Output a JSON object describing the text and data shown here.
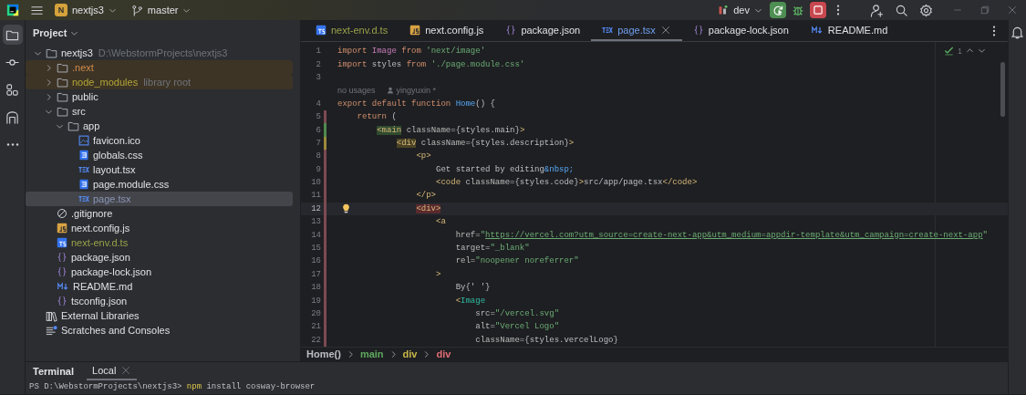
{
  "titlebar": {
    "project": {
      "badge": "N",
      "name": "nextjs3"
    },
    "branch": "master",
    "run_config": "dev"
  },
  "toolstrip": [
    {
      "kind": "folder",
      "selected": true
    },
    {
      "kind": "commit",
      "selected": false
    },
    {
      "kind": "structure",
      "selected": false
    },
    {
      "kind": "arch",
      "selected": false
    },
    {
      "kind": "more",
      "selected": false
    }
  ],
  "project": {
    "title": "Project",
    "tree": [
      {
        "label": "nextjs3",
        "hint": "D:\\WebstormProjects\\nextjs3",
        "kind": "folder",
        "expanded": true,
        "selected": false,
        "highlighted": false,
        "children": [
          {
            "label": ".next",
            "kind": "folder",
            "expanded": false,
            "selected": false,
            "highlighted": true,
            "color": "#d08b4c"
          },
          {
            "label": "node_modules",
            "hint": "library root",
            "kind": "folder",
            "expanded": false,
            "selected": false,
            "highlighted": true,
            "color": "#b3a536"
          },
          {
            "label": "public",
            "kind": "folder",
            "expanded": false,
            "selected": false,
            "highlighted": false
          },
          {
            "label": "src",
            "kind": "folder",
            "expanded": true,
            "selected": false,
            "highlighted": false,
            "children": [
              {
                "label": "app",
                "kind": "folder",
                "expanded": true,
                "selected": false,
                "highlighted": false,
                "children": [
                  {
                    "label": "favicon.ico",
                    "kind": "image",
                    "selected": false,
                    "highlighted": false
                  },
                  {
                    "label": "globals.css",
                    "kind": "css",
                    "selected": false,
                    "highlighted": false
                  },
                  {
                    "label": "layout.tsx",
                    "kind": "tsx",
                    "selected": false,
                    "highlighted": false
                  },
                  {
                    "label": "page.module.css",
                    "kind": "css",
                    "selected": false,
                    "highlighted": false
                  },
                  {
                    "label": "page.tsx",
                    "kind": "tsx",
                    "selected": true,
                    "highlighted": false,
                    "color": "#8b95b5"
                  }
                ]
              }
            ]
          },
          {
            "label": ".gitignore",
            "kind": "ignore",
            "selected": false,
            "highlighted": false
          },
          {
            "label": "next.config.js",
            "kind": "js",
            "selected": false,
            "highlighted": false
          },
          {
            "label": "next-env.d.ts",
            "kind": "ts",
            "selected": false,
            "highlighted": false,
            "color": "#9aa24a"
          },
          {
            "label": "package.json",
            "kind": "json",
            "selected": false,
            "highlighted": false
          },
          {
            "label": "package-lock.json",
            "kind": "json",
            "selected": false,
            "highlighted": false
          },
          {
            "label": "README.md",
            "kind": "md",
            "selected": false,
            "highlighted": false
          },
          {
            "label": "tsconfig.json",
            "kind": "json",
            "selected": false,
            "highlighted": false
          }
        ]
      },
      {
        "label": "External Libraries",
        "kind": "libraries",
        "selected": false,
        "highlighted": false
      },
      {
        "label": "Scratches and Consoles",
        "kind": "scratches",
        "selected": false,
        "highlighted": false
      }
    ]
  },
  "editor": {
    "tabs": [
      {
        "label": "next-env.d.ts",
        "kind": "ts",
        "selected": false,
        "color": "#9aa24a"
      },
      {
        "label": "next.config.js",
        "kind": "js",
        "selected": false,
        "color": "#dfe1e5"
      },
      {
        "label": "package.json",
        "kind": "json",
        "selected": false,
        "color": "#dfe1e5"
      },
      {
        "label": "page.tsx",
        "kind": "tsx",
        "selected": true,
        "color": "#6f9ff0"
      },
      {
        "label": "package-lock.json",
        "kind": "json",
        "selected": false,
        "color": "#dfe1e5"
      },
      {
        "label": "README.md",
        "kind": "md",
        "selected": false,
        "color": "#dfe1e5"
      }
    ],
    "inspection": {
      "count": "1"
    },
    "lines": [
      {
        "kind": "code",
        "number": "1",
        "current": false,
        "tokens": [
          {
            "kind": "kw",
            "text": "import "
          },
          {
            "kind": "type",
            "text": "Image"
          },
          {
            "kind": "kw",
            "text": " from "
          },
          {
            "kind": "str",
            "text": "'next/image'"
          }
        ]
      },
      {
        "kind": "code",
        "number": "2",
        "current": false,
        "tokens": [
          {
            "kind": "kw",
            "text": "import "
          },
          {
            "kind": "plain",
            "text": "styles "
          },
          {
            "kind": "kw",
            "text": "from "
          },
          {
            "kind": "str",
            "text": "'./page.module.css'"
          }
        ]
      },
      {
        "kind": "code",
        "number": "3",
        "current": false
      },
      {
        "kind": "hint",
        "usages": "no usages",
        "author": "yingyuxin *"
      },
      {
        "kind": "code",
        "number": "4",
        "current": false,
        "tokens": [
          {
            "kind": "kw",
            "text": "export default function "
          },
          {
            "kind": "fn",
            "text": "Home"
          },
          {
            "kind": "plain",
            "text": "() {"
          }
        ]
      },
      {
        "kind": "code",
        "number": "5",
        "current": false,
        "color": "#7c4a52",
        "tokens": [
          {
            "kind": "kw",
            "text": "    return"
          },
          {
            "kind": "plain",
            "text": " ("
          }
        ]
      },
      {
        "kind": "code",
        "number": "6",
        "current": false,
        "color": "#4f8a4f",
        "tokens": [
          {
            "kind": "tag-scope",
            "text": "        <main"
          },
          {
            "kind": "attr",
            "text": " className"
          },
          {
            "kind": "plain",
            "text": "={styles.main}"
          },
          {
            "kind": "tag",
            "text": ">"
          }
        ]
      },
      {
        "kind": "code",
        "number": "7",
        "current": false,
        "color": "#9b8a3c",
        "tokens": [
          {
            "kind": "tag-parent",
            "text": "            <div"
          },
          {
            "kind": "attr",
            "text": " className"
          },
          {
            "kind": "plain",
            "text": "={styles.description}"
          },
          {
            "kind": "tag",
            "text": ">"
          }
        ]
      },
      {
        "kind": "code",
        "number": "8",
        "current": false,
        "color": "#7c4a52",
        "tokens": [
          {
            "kind": "tag",
            "text": "                <p>"
          }
        ]
      },
      {
        "kind": "code",
        "number": "9",
        "current": false,
        "color": "#7c4a52",
        "tokens": [
          {
            "kind": "plain",
            "text": "                    Get started by editing"
          },
          {
            "kind": "entity",
            "text": "&nbsp;"
          }
        ]
      },
      {
        "kind": "code",
        "number": "10",
        "current": false,
        "color": "#7c4a52",
        "tokens": [
          {
            "kind": "tag",
            "text": "                    <code"
          },
          {
            "kind": "attr",
            "text": " className"
          },
          {
            "kind": "plain",
            "text": "={styles.code}"
          },
          {
            "kind": "tag",
            "text": ">"
          },
          {
            "kind": "plain",
            "text": "src/app/page.tsx"
          },
          {
            "kind": "tag",
            "text": "</code>"
          }
        ]
      },
      {
        "kind": "code",
        "number": "11",
        "current": false,
        "color": "#7c4a52",
        "tokens": [
          {
            "kind": "tag",
            "text": "                </p>"
          }
        ]
      },
      {
        "kind": "code",
        "number": "12",
        "current": true,
        "color": "#7c4a52",
        "tokens": [
          {
            "kind": "tag-current",
            "text": "                <div>"
          }
        ]
      },
      {
        "kind": "code",
        "number": "13",
        "current": false,
        "color": "#7c4a52",
        "tokens": [
          {
            "kind": "tag",
            "text": "                    <a"
          }
        ]
      },
      {
        "kind": "code",
        "number": "14",
        "current": false,
        "color": "#7c4a52",
        "tokens": [
          {
            "kind": "attr",
            "text": "                        href="
          },
          {
            "kind": "str",
            "text": "\""
          },
          {
            "kind": "link",
            "text": "https://vercel.com?utm_source=create-next-app&utm_medium=appdir-template&utm_campaign=create-next-app"
          },
          {
            "kind": "str",
            "text": "\""
          }
        ]
      },
      {
        "kind": "code",
        "number": "15",
        "current": false,
        "color": "#7c4a52",
        "tokens": [
          {
            "kind": "attr",
            "text": "                        target="
          },
          {
            "kind": "str",
            "text": "\"_blank\""
          }
        ]
      },
      {
        "kind": "code",
        "number": "16",
        "current": false,
        "color": "#7c4a52",
        "tokens": [
          {
            "kind": "attr",
            "text": "                        rel="
          },
          {
            "kind": "str",
            "text": "\"noopener noreferrer\""
          }
        ]
      },
      {
        "kind": "code",
        "number": "17",
        "current": false,
        "color": "#7c4a52",
        "tokens": [
          {
            "kind": "tag",
            "text": "                    >"
          }
        ]
      },
      {
        "kind": "code",
        "number": "18",
        "current": false,
        "color": "#7c4a52",
        "tokens": [
          {
            "kind": "plain",
            "text": "                        By{' '}"
          }
        ]
      },
      {
        "kind": "code",
        "number": "19",
        "current": false,
        "color": "#7c4a52",
        "tokens": [
          {
            "kind": "tag",
            "text": "                        <"
          },
          {
            "kind": "comp",
            "text": "Image"
          }
        ]
      },
      {
        "kind": "code",
        "number": "20",
        "current": false,
        "color": "#7c4a52",
        "tokens": [
          {
            "kind": "attr",
            "text": "                            src="
          },
          {
            "kind": "str",
            "text": "\"/vercel.svg\""
          }
        ]
      },
      {
        "kind": "code",
        "number": "21",
        "current": false,
        "color": "#7c4a52",
        "tokens": [
          {
            "kind": "attr",
            "text": "                            alt="
          },
          {
            "kind": "str",
            "text": "\"Vercel Logo\""
          }
        ]
      },
      {
        "kind": "code",
        "number": "22",
        "current": false,
        "color": "#7c4a52",
        "tokens": [
          {
            "kind": "attr",
            "text": "                            className="
          },
          {
            "kind": "plain",
            "text": "{styles.vercelLogo}"
          }
        ]
      }
    ],
    "breadcrumb": [
      {
        "label": "Home()",
        "color": "#bcbec4"
      },
      {
        "label": "main",
        "color": "#5fa85f"
      },
      {
        "label": "div",
        "color": "#c9b84a"
      },
      {
        "label": "div",
        "color": "#e06c75"
      }
    ]
  },
  "terminal": {
    "title": "Terminal",
    "tabs": [
      {
        "label": "Local",
        "selected": true
      }
    ],
    "lines": [
      [
        {
          "kind": "prompt",
          "text": "PS D:\\WebstormProjects\\nextjs3> "
        },
        {
          "kind": "command",
          "text": "npm"
        },
        {
          "kind": "args",
          "text": " install cosway-browser"
        }
      ]
    ]
  }
}
